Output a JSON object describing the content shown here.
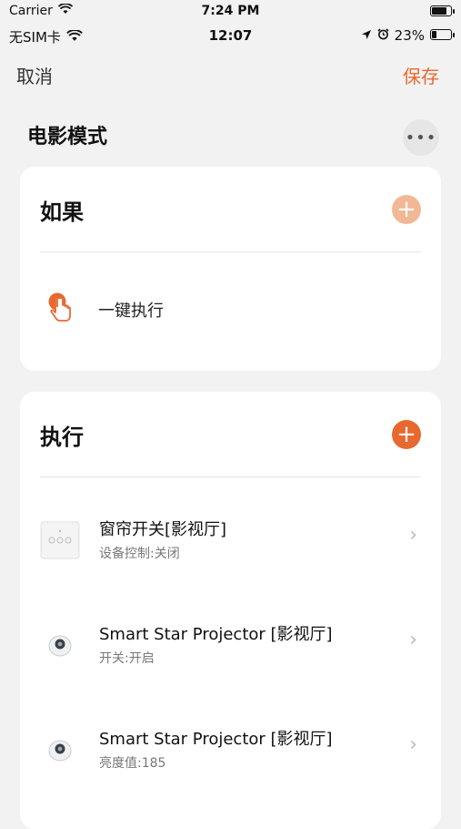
{
  "outer_status": {
    "carrier": "Carrier",
    "time": "7:24 PM",
    "battery_level": 0.8
  },
  "inner_status": {
    "carrier": "无SIM卡",
    "time": "12:07",
    "battery": "23%",
    "battery_level": 0.23
  },
  "nav": {
    "cancel_label": "取消",
    "save_label": "保存"
  },
  "scene": {
    "title": "电影模式",
    "more_label": "•••"
  },
  "if_card": {
    "header": "如果",
    "add_label": "+",
    "trigger": {
      "label": "一键执行",
      "icon": "tap-hand-icon"
    }
  },
  "do_card": {
    "header": "执行",
    "add_label": "+",
    "actions": [
      {
        "title": "窗帘开关[影视厅]",
        "subtitle": "设备控制:关闭",
        "icon": "curtain-switch-icon"
      },
      {
        "title": "Smart Star Projector [影视厅]",
        "subtitle": "开关:开启",
        "icon": "projector-icon"
      },
      {
        "title": "Smart Star Projector [影视厅]",
        "subtitle": "亮度值:185",
        "icon": "projector-icon"
      }
    ]
  },
  "colors": {
    "accent": "#e8692f",
    "accent_light": "#f2b896",
    "background": "#f2f2f2"
  }
}
